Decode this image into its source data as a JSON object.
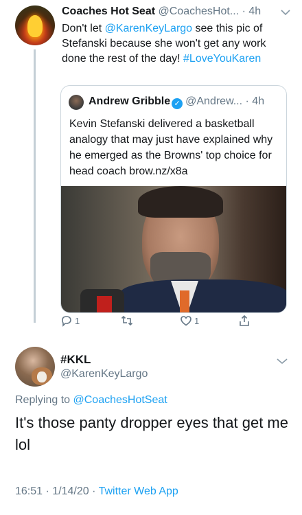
{
  "tweet1": {
    "name": "Coaches Hot Seat",
    "meta": " @CoachesHot... · 4h",
    "body_pre": "Don't let ",
    "mention": "@KarenKeyLargo",
    "body_mid": " see this pic of Stefanski because she won't get any work done the rest of the day! ",
    "hashtag": "#LoveYouKaren"
  },
  "quote": {
    "name": "Andrew Gribble",
    "meta": "@Andrew... · 4h",
    "body": "Kevin Stefanski delivered a basketball analogy that may just have explained why he emerged as the Browns' top choice for head coach brow.nz/x8a"
  },
  "actions": {
    "reply_count": "1",
    "retweet_count": "",
    "like_count": "1"
  },
  "tweet2": {
    "name": "#KKL",
    "handle": "@KarenKeyLargo",
    "replying_label": "Replying to ",
    "replying_to": "@CoachesHotSeat",
    "body": "It's those panty dropper eyes that get me lol",
    "meta_time": "16:51 · 1/14/20 · ",
    "meta_app": "Twitter Web App"
  },
  "icons": [
    "reply-icon",
    "retweet-icon",
    "like-icon",
    "share-icon",
    "chevron-down-icon",
    "verified-badge-icon"
  ],
  "colors": {
    "link": "#1da1f2",
    "muted": "#657786",
    "text": "#14171a",
    "border": "#ccd6dd"
  }
}
